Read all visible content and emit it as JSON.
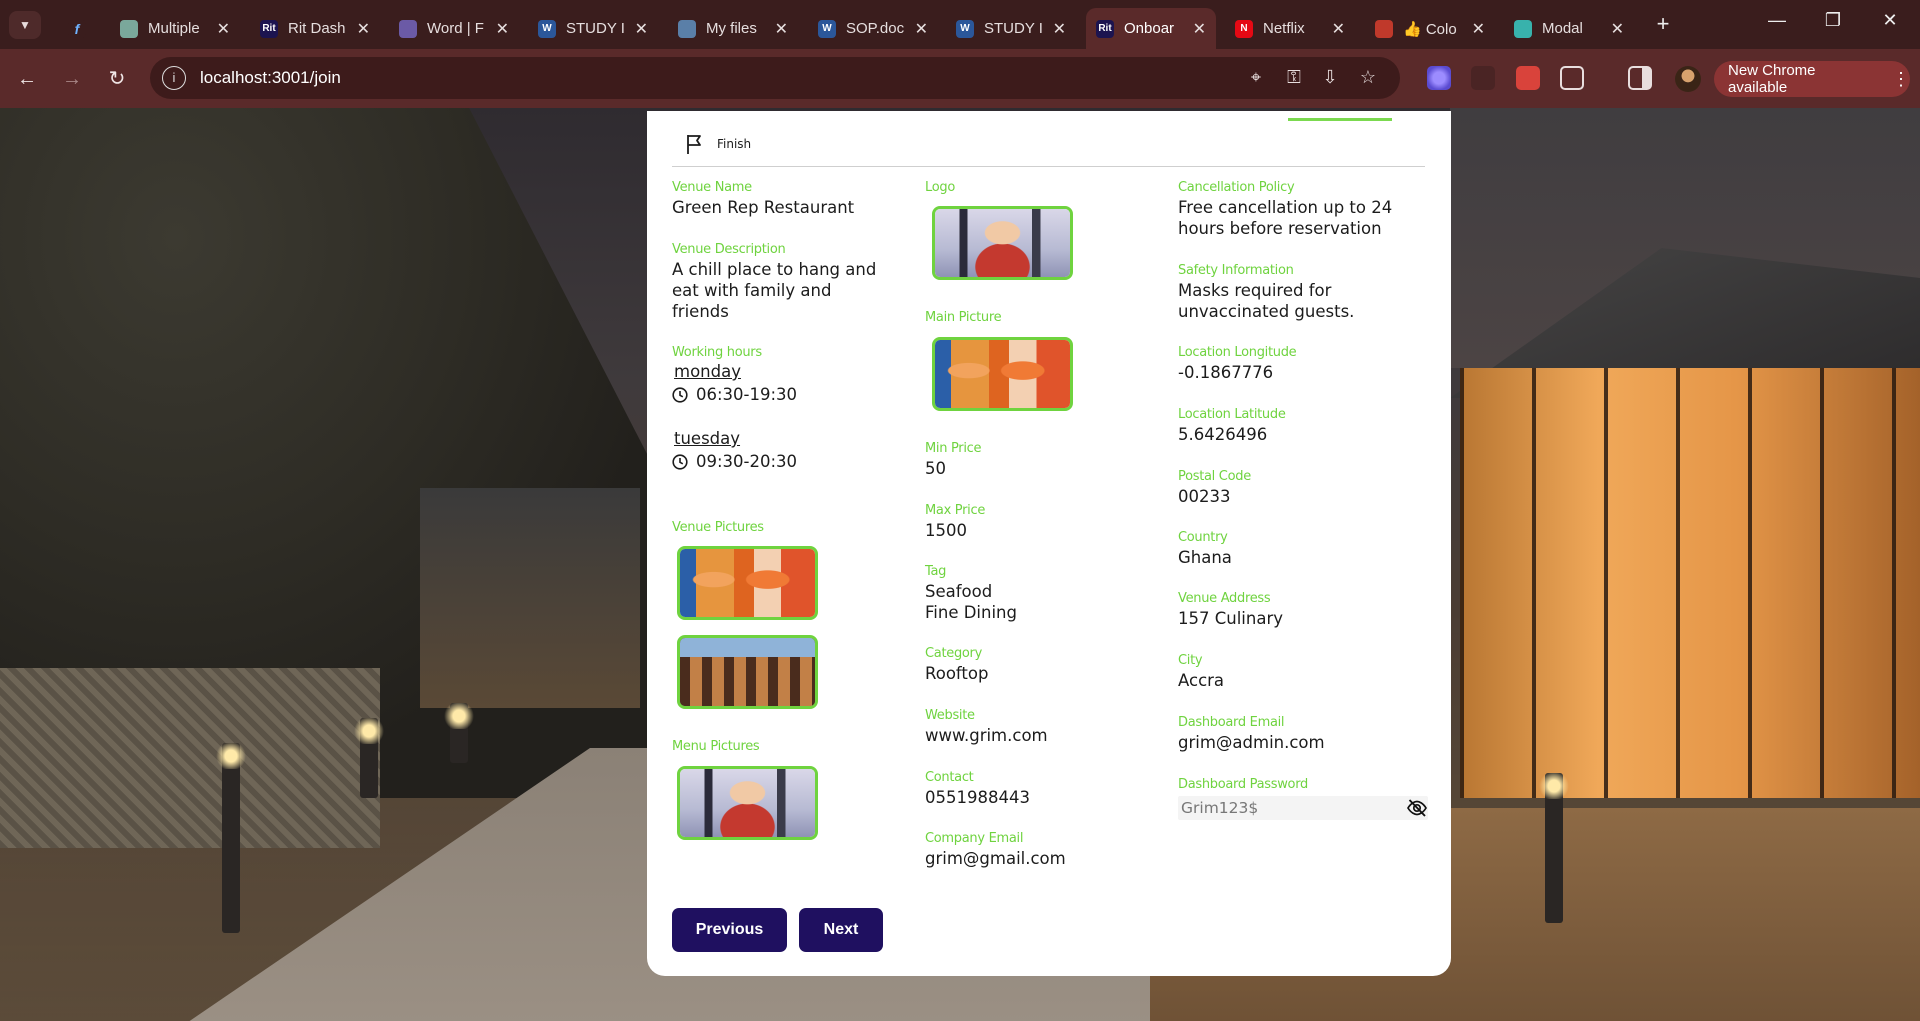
{
  "browser": {
    "tabs": [
      {
        "title": "",
        "favicon_color": "#3a1d1d",
        "favicon_text": "f",
        "active": false
      },
      {
        "title": "Multiple",
        "favicon_color": "#7aa89b",
        "favicon_text": "",
        "active": false
      },
      {
        "title": "Rit Dash",
        "favicon_color": "#1c1450",
        "favicon_text": "Rit",
        "active": false
      },
      {
        "title": "Word | F",
        "favicon_color": "#6b5aa6",
        "favicon_text": "",
        "active": false
      },
      {
        "title": "STUDY I",
        "favicon_color": "#2b579a",
        "favicon_text": "W",
        "active": false
      },
      {
        "title": "My files",
        "favicon_color": "#5a7fa8",
        "favicon_text": "",
        "active": false
      },
      {
        "title": "SOP.doc",
        "favicon_color": "#2b579a",
        "favicon_text": "W",
        "active": false
      },
      {
        "title": "STUDY I",
        "favicon_color": "#2b579a",
        "favicon_text": "W",
        "active": false
      },
      {
        "title": "Onboar",
        "favicon_color": "#1c1450",
        "favicon_text": "Rit",
        "active": true
      },
      {
        "title": "Netflix",
        "favicon_color": "#e50914",
        "favicon_text": "N",
        "active": false
      },
      {
        "title": "👍 Colo",
        "favicon_color": "#c0392b",
        "favicon_text": "",
        "active": false
      },
      {
        "title": "Modal",
        "favicon_color": "#38b2ac",
        "favicon_text": "",
        "active": false
      }
    ],
    "new_tab_label": "+",
    "url": "localhost:3001/join",
    "update_label": "New Chrome available"
  },
  "form": {
    "step_label": "Finish",
    "venue_name": {
      "label": "Venue Name",
      "value": "Green Rep Restaurant"
    },
    "venue_description": {
      "label": "Venue Description",
      "value": "A chill place to hang and eat with family and friends"
    },
    "working_hours": {
      "label": "Working hours",
      "days": [
        {
          "day": "monday",
          "hours": "06:30-19:30"
        },
        {
          "day": "tuesday",
          "hours": "09:30-20:30"
        }
      ]
    },
    "venue_pictures": {
      "label": "Venue Pictures"
    },
    "menu_pictures": {
      "label": "Menu Pictures"
    },
    "logo": {
      "label": "Logo"
    },
    "main_picture": {
      "label": "Main Picture"
    },
    "min_price": {
      "label": "Min Price",
      "value": "50"
    },
    "max_price": {
      "label": "Max Price",
      "value": "1500"
    },
    "tag": {
      "label": "Tag",
      "values": [
        "Seafood",
        "Fine Dining"
      ]
    },
    "category": {
      "label": "Category",
      "value": "Rooftop"
    },
    "website": {
      "label": "Website",
      "value": "www.grim.com"
    },
    "contact": {
      "label": "Contact",
      "value": "0551988443"
    },
    "company_email": {
      "label": "Company Email",
      "value": "grim@gmail.com"
    },
    "cancellation_policy": {
      "label": "Cancellation Policy",
      "value": "Free cancellation up to 24 hours before reservation"
    },
    "safety_information": {
      "label": "Safety Information",
      "value": "Masks required for unvaccinated guests."
    },
    "location_longitude": {
      "label": "Location Longitude",
      "value": "-0.1867776"
    },
    "location_latitude": {
      "label": "Location Latitude",
      "value": "5.6426496"
    },
    "postal_code": {
      "label": "Postal Code",
      "value": "00233"
    },
    "country": {
      "label": "Country",
      "value": "Ghana"
    },
    "venue_address": {
      "label": "Venue Address",
      "value": "157 Culinary"
    },
    "city": {
      "label": "City",
      "value": "Accra"
    },
    "dashboard_email": {
      "label": "Dashboard Email",
      "value": "grim@admin.com"
    },
    "dashboard_password": {
      "label": "Dashboard Password",
      "value": "Grim123$"
    },
    "buttons": {
      "previous": "Previous",
      "next": "Next"
    }
  },
  "colors": {
    "accent_green": "#6fd33f",
    "button_navy": "#1f1060",
    "chrome_frame": "#3a1d1d",
    "chrome_toolbar": "#5a2a2a"
  }
}
